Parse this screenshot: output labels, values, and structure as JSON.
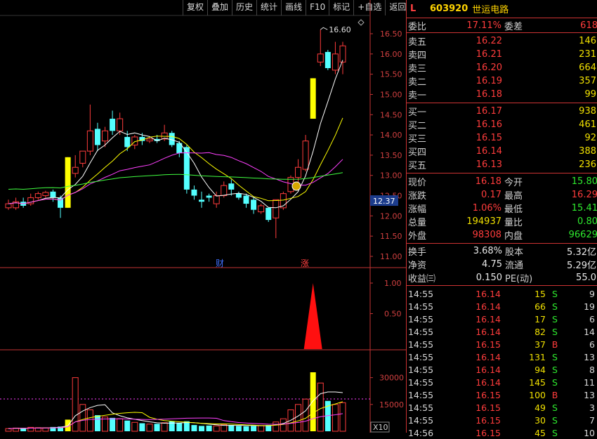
{
  "toolbar": {
    "buttons": [
      "复权",
      "叠加",
      "历史",
      "统计",
      "画线",
      "F10",
      "标记",
      "+自选",
      "返回"
    ]
  },
  "chart": {
    "price_axis": [
      "16.50",
      "16.00",
      "15.50",
      "15.00",
      "14.50",
      "14.00",
      "13.50",
      "13.00",
      "12.50",
      "12.00",
      "11.50",
      "11.00"
    ],
    "current_price_tag": "12.37",
    "high_label": "16.60",
    "indicator_axis": [
      "1.00",
      "0.50"
    ],
    "volume_axis": [
      "30000",
      "15000"
    ],
    "volume_unit": "X10",
    "marker_cai": "财",
    "marker_zhang": "涨",
    "colors": {
      "up": "#ff3c3c",
      "down": "#54ffff",
      "limit_up": "#ffff00",
      "ma5": "#ffffff",
      "ma10": "#ffff00",
      "ma20": "#ff40ff",
      "ma60": "#40ff40",
      "frame": "#c33333"
    }
  },
  "chart_data": {
    "type": "candlestick",
    "ylim": [
      11.0,
      16.75
    ],
    "candles": [
      {
        "o": 12.2,
        "c": 12.3,
        "h": 12.4,
        "l": 12.15
      },
      {
        "o": 12.2,
        "c": 12.35,
        "h": 12.45,
        "l": 12.15
      },
      {
        "o": 12.35,
        "c": 12.25,
        "h": 12.45,
        "l": 12.2
      },
      {
        "o": 12.3,
        "c": 12.45,
        "h": 12.55,
        "l": 12.25
      },
      {
        "o": 12.45,
        "c": 12.55,
        "h": 12.6,
        "l": 12.4
      },
      {
        "o": 12.5,
        "c": 12.58,
        "h": 12.62,
        "l": 12.45
      },
      {
        "o": 12.6,
        "c": 12.45,
        "h": 12.65,
        "l": 12.35
      },
      {
        "o": 12.45,
        "c": 12.2,
        "h": 12.5,
        "l": 11.95
      },
      {
        "o": 12.2,
        "c": 13.45,
        "h": 13.45,
        "l": 12.2,
        "limit": true
      },
      {
        "o": 13.05,
        "c": 13.2,
        "h": 13.5,
        "l": 12.95
      },
      {
        "o": 13.3,
        "c": 13.6,
        "h": 13.6,
        "l": 13.2
      },
      {
        "o": 13.6,
        "c": 14.1,
        "h": 14.75,
        "l": 13.5
      },
      {
        "o": 14.15,
        "c": 13.75,
        "h": 14.3,
        "l": 13.6
      },
      {
        "o": 13.85,
        "c": 14.1,
        "h": 14.2,
        "l": 13.7
      },
      {
        "o": 14.4,
        "c": 14.1,
        "h": 14.6,
        "l": 14.0
      },
      {
        "o": 14.1,
        "c": 14.4,
        "h": 14.55,
        "l": 14.0
      },
      {
        "o": 13.95,
        "c": 13.7,
        "h": 14.1,
        "l": 13.6
      },
      {
        "o": 13.75,
        "c": 13.95,
        "h": 14.0,
        "l": 13.65
      },
      {
        "o": 13.95,
        "c": 13.85,
        "h": 14.05,
        "l": 13.75
      },
      {
        "o": 13.85,
        "c": 13.9,
        "h": 13.95,
        "l": 13.8
      },
      {
        "o": 13.9,
        "c": 13.85,
        "h": 14.0,
        "l": 13.8
      },
      {
        "o": 13.9,
        "c": 14.05,
        "h": 14.25,
        "l": 13.85
      },
      {
        "o": 14.05,
        "c": 13.75,
        "h": 14.1,
        "l": 13.7
      },
      {
        "o": 13.8,
        "c": 13.55,
        "h": 13.85,
        "l": 13.45
      },
      {
        "o": 13.7,
        "c": 12.65,
        "h": 13.75,
        "l": 12.55
      },
      {
        "o": 12.65,
        "c": 12.5,
        "h": 12.75,
        "l": 12.4
      },
      {
        "o": 12.4,
        "c": 12.35,
        "h": 12.6,
        "l": 12.2
      },
      {
        "o": 12.5,
        "c": 12.45,
        "h": 12.55,
        "l": 12.35
      },
      {
        "o": 12.3,
        "c": 12.5,
        "h": 12.6,
        "l": 12.2
      },
      {
        "o": 12.5,
        "c": 12.75,
        "h": 12.85,
        "l": 12.45
      },
      {
        "o": 12.8,
        "c": 12.65,
        "h": 12.9,
        "l": 12.5
      },
      {
        "o": 12.55,
        "c": 12.45,
        "h": 12.6,
        "l": 12.4
      },
      {
        "o": 12.5,
        "c": 12.3,
        "h": 12.55,
        "l": 12.2
      },
      {
        "o": 12.4,
        "c": 12.15,
        "h": 12.45,
        "l": 12.05
      },
      {
        "o": 12.1,
        "c": 12.25,
        "h": 12.3,
        "l": 12.05
      },
      {
        "o": 12.2,
        "c": 11.9,
        "h": 12.2,
        "l": 11.85
      },
      {
        "o": 11.95,
        "c": 12.4,
        "h": 12.4,
        "l": 11.45
      },
      {
        "o": 12.2,
        "c": 12.55,
        "h": 12.6,
        "l": 12.15
      },
      {
        "o": 12.6,
        "c": 12.95,
        "h": 13.0,
        "l": 12.55
      },
      {
        "o": 12.95,
        "c": 13.2,
        "h": 13.4,
        "l": 12.8
      },
      {
        "o": 13.15,
        "c": 13.85,
        "h": 14.0,
        "l": 13.1
      },
      {
        "o": 14.4,
        "c": 15.4,
        "h": 15.4,
        "l": 14.4,
        "limit": true
      },
      {
        "o": 15.8,
        "c": 16.0,
        "h": 16.6,
        "l": 15.7
      },
      {
        "o": 16.05,
        "c": 15.65,
        "h": 16.1,
        "l": 15.6
      },
      {
        "o": 15.6,
        "c": 16.0,
        "h": 16.3,
        "l": 15.5
      },
      {
        "o": 15.8,
        "c": 16.2,
        "h": 16.3,
        "l": 15.5
      }
    ],
    "volume": [
      1500,
      1800,
      1600,
      2200,
      2000,
      1900,
      2400,
      2600,
      6500,
      30000,
      15000,
      12000,
      9000,
      8000,
      7500,
      7000,
      6000,
      5000,
      4500,
      4000,
      4200,
      4800,
      5500,
      4500,
      5600,
      3500,
      3000,
      3200,
      3000,
      3800,
      3500,
      3000,
      2800,
      3000,
      3200,
      3500,
      5200,
      7000,
      12000,
      15000,
      18000,
      33000,
      27000,
      17000,
      15000,
      16000
    ],
    "indicator": {
      "spike_index": 41,
      "value": 1.0
    }
  },
  "quote": {
    "market_tag": "L",
    "code": "603920",
    "name": "世运电路",
    "weibi_label": "委比",
    "weibi_value": "17.11%",
    "weicha_label": "委差",
    "weicha_value": "618",
    "sells": [
      {
        "label": "卖五",
        "price": "16.22",
        "vol": "146"
      },
      {
        "label": "卖四",
        "price": "16.21",
        "vol": "231"
      },
      {
        "label": "卖三",
        "price": "16.20",
        "vol": "664"
      },
      {
        "label": "卖二",
        "price": "16.19",
        "vol": "357"
      },
      {
        "label": "卖一",
        "price": "16.18",
        "vol": "99"
      }
    ],
    "buys": [
      {
        "label": "买一",
        "price": "16.17",
        "vol": "938"
      },
      {
        "label": "买二",
        "price": "16.16",
        "vol": "461"
      },
      {
        "label": "买三",
        "price": "16.15",
        "vol": "92"
      },
      {
        "label": "买四",
        "price": "16.14",
        "vol": "388"
      },
      {
        "label": "买五",
        "price": "16.13",
        "vol": "236"
      }
    ],
    "stats": [
      {
        "l1": "现价",
        "v1": "16.18",
        "c1": "red",
        "l2": "今开",
        "v2": "15.80",
        "c2": "green"
      },
      {
        "l1": "涨跌",
        "v1": "0.17",
        "c1": "red",
        "l2": "最高",
        "v2": "16.29",
        "c2": "red"
      },
      {
        "l1": "涨幅",
        "v1": "1.06%",
        "c1": "red",
        "l2": "最低",
        "v2": "15.41",
        "c2": "green"
      },
      {
        "l1": "总量",
        "v1": "194937",
        "c1": "yellow",
        "l2": "量比",
        "v2": "0.80",
        "c2": "green"
      },
      {
        "l1": "外盘",
        "v1": "98308",
        "c1": "red",
        "l2": "内盘",
        "v2": "96629",
        "c2": "green"
      }
    ],
    "fundamentals": [
      {
        "l1": "换手",
        "v1": "3.68%",
        "l2": "股本",
        "v2": "5.32亿"
      },
      {
        "l1": "净资",
        "v1": "4.75",
        "l2": "流通",
        "v2": "5.29亿"
      },
      {
        "l1": "收益㈢",
        "v1": "0.150",
        "l2": "PE(动)",
        "v2": "55.0"
      }
    ],
    "ticks": [
      {
        "t": "14:55",
        "p": "16.14",
        "pc": "red",
        "v": "15",
        "d": "S",
        "dc": "green",
        "c": "9"
      },
      {
        "t": "14:55",
        "p": "16.14",
        "pc": "red",
        "v": "66",
        "d": "S",
        "dc": "green",
        "c": "19"
      },
      {
        "t": "14:55",
        "p": "16.14",
        "pc": "red",
        "v": "17",
        "d": "S",
        "dc": "green",
        "c": "6"
      },
      {
        "t": "14:55",
        "p": "16.14",
        "pc": "red",
        "v": "82",
        "d": "S",
        "dc": "green",
        "c": "14"
      },
      {
        "t": "14:55",
        "p": "16.15",
        "pc": "red",
        "v": "37",
        "d": "B",
        "dc": "red",
        "c": "6"
      },
      {
        "t": "14:55",
        "p": "16.14",
        "pc": "red",
        "v": "131",
        "d": "S",
        "dc": "green",
        "c": "13"
      },
      {
        "t": "14:55",
        "p": "16.14",
        "pc": "red",
        "v": "94",
        "d": "S",
        "dc": "green",
        "c": "8"
      },
      {
        "t": "14:55",
        "p": "16.14",
        "pc": "red",
        "v": "145",
        "d": "S",
        "dc": "green",
        "c": "11"
      },
      {
        "t": "14:55",
        "p": "16.15",
        "pc": "red",
        "v": "100",
        "d": "B",
        "dc": "red",
        "c": "13"
      },
      {
        "t": "14:55",
        "p": "16.15",
        "pc": "red",
        "v": "49",
        "d": "S",
        "dc": "green",
        "c": "3"
      },
      {
        "t": "14:55",
        "p": "16.15",
        "pc": "red",
        "v": "30",
        "d": "S",
        "dc": "green",
        "c": "7"
      },
      {
        "t": "14:56",
        "p": "16.15",
        "pc": "red",
        "v": "45",
        "d": "S",
        "dc": "green",
        "c": "10"
      }
    ]
  }
}
